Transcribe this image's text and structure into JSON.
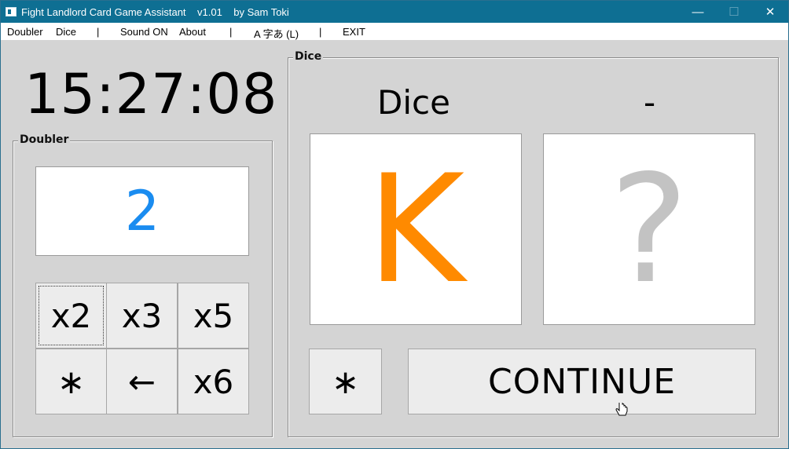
{
  "window": {
    "title": "Fight Landlord Card Game Assistant    v1.01    by Sam Toki",
    "controls": {
      "minimize": "—",
      "maximize": "☐",
      "close": "✕"
    }
  },
  "menu": {
    "doubler": "Doubler",
    "dice": "Dice",
    "sound": "Sound ON",
    "about": "About",
    "language": "A 字あ (L)",
    "exit": "EXIT",
    "separator": "|"
  },
  "clock": "15:27:08",
  "doubler": {
    "legend": "Doubler",
    "value": "2",
    "buttons": [
      "x2",
      "x3",
      "x5",
      "∗",
      "←",
      "x6"
    ]
  },
  "dice": {
    "legend": "Dice",
    "label_left": "Dice",
    "label_right": "-",
    "card_left": "K",
    "card_right": "?",
    "star_button": "∗",
    "continue_button": "CONTINUE"
  },
  "colors": {
    "doubler_value": "#1a8cf0",
    "card_left": "#ff8a00",
    "card_right": "#c3c3c3",
    "titlebar": "#0e6f93"
  }
}
